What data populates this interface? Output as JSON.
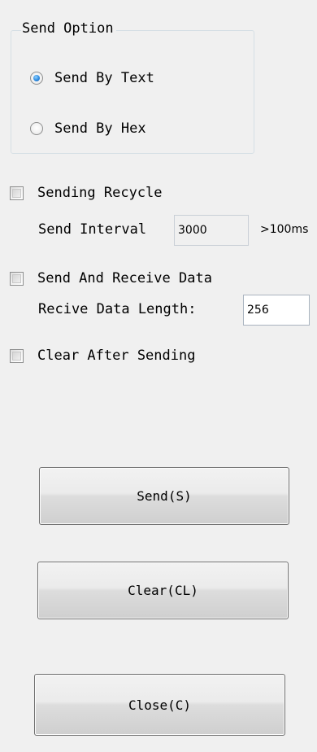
{
  "send_option": {
    "title": "Send Option",
    "options": [
      {
        "label": "Send By Text",
        "checked": true
      },
      {
        "label": "Send By Hex",
        "checked": false
      }
    ]
  },
  "sending_recycle": {
    "label": "Sending Recycle",
    "checked": false,
    "interval_label": "Send Interval",
    "interval_value": "3000",
    "interval_units": ">100ms"
  },
  "send_and_receive": {
    "label": "Send And Receive Data",
    "checked": false,
    "length_label": "Recive Data Length:",
    "length_value": "256"
  },
  "clear_after_sending": {
    "label": "Clear After Sending",
    "checked": false
  },
  "buttons": {
    "send": "Send(S)",
    "clear": "Clear(CL)",
    "close": "Close(C)"
  }
}
